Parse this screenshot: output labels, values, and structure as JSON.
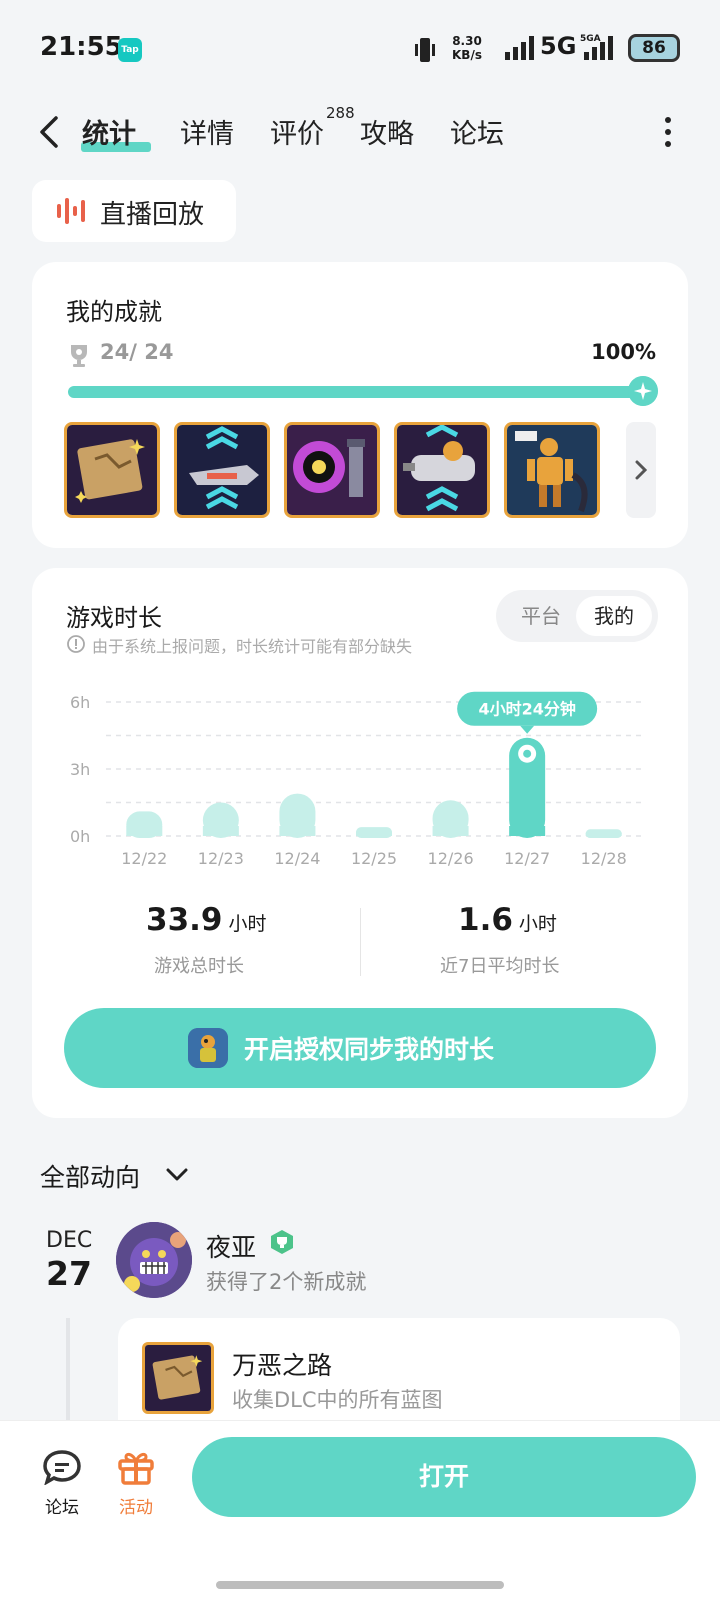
{
  "status_bar": {
    "time": "21:55",
    "app_badge": "Tap",
    "net_speed_value": "8.30",
    "net_speed_unit": "KB/s",
    "network": "5G",
    "network2": "5GA",
    "battery": "86"
  },
  "nav": {
    "tabs": [
      {
        "label": "统计",
        "active": true
      },
      {
        "label": "详情"
      },
      {
        "label": "评价"
      },
      {
        "label": "攻略"
      },
      {
        "label": "论坛"
      }
    ],
    "review_count": "288"
  },
  "replay": {
    "label": "直播回放"
  },
  "achievements": {
    "title": "我的成就",
    "count": "24/ 24",
    "percent": "100%",
    "progress": 1.0
  },
  "playtime": {
    "title": "游戏时长",
    "toggle": [
      "平台",
      "我的"
    ],
    "toggle_selected": "我的",
    "notice": "由于系统上报问题，时长统计可能有部分缺失",
    "total_value": "33.9",
    "total_unit": "小时",
    "total_label": "游戏总时长",
    "avg_value": "1.6",
    "avg_unit": "小时",
    "avg_label": "近7日平均时长",
    "sync_label": "开启授权同步我的时长"
  },
  "chart_data": {
    "type": "bar",
    "categories": [
      "12/22",
      "12/23",
      "12/24",
      "12/25",
      "12/26",
      "12/27",
      "12/28"
    ],
    "values": [
      1.1,
      1.5,
      1.9,
      0.4,
      1.6,
      4.4,
      0.3
    ],
    "yticks": [
      "6h",
      "3h",
      "0h"
    ],
    "ylim": [
      0,
      6
    ],
    "highlight_index": 5,
    "highlight_label": "4小时24分钟",
    "colors": {
      "bar": "#c6efe9",
      "highlight": "#5fd6c6"
    }
  },
  "feed": {
    "header": "全部动向",
    "month": "DEC",
    "day": "27",
    "user": "夜亚",
    "action": "获得了2个新成就",
    "item_name": "万恶之路",
    "item_desc": "收集DLC中的所有蓝图"
  },
  "bottom_bar": {
    "forum": "论坛",
    "activity": "活动",
    "open": "打开"
  },
  "colors": {
    "accent": "#5fd6c6",
    "activity": "#f07d3a",
    "replay_icon": "#e8614a"
  }
}
